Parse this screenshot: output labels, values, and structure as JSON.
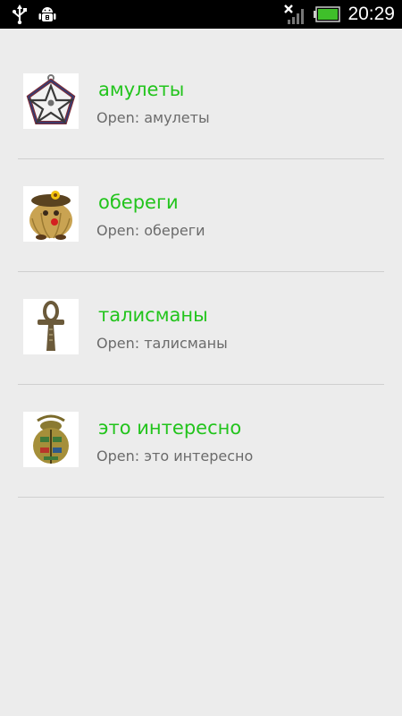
{
  "status_bar": {
    "time": "20:29",
    "icons": [
      "usb-icon",
      "android-debug-icon",
      "no-signal-icon",
      "battery-icon"
    ],
    "battery_color": "#3fbf2a"
  },
  "list": {
    "accent_color": "#22c41c",
    "items": [
      {
        "title": "амулеты",
        "subtitle": "Open: амулеты",
        "icon": "pentagram-amulet-icon"
      },
      {
        "title": "обереги",
        "subtitle": "Open: обереги",
        "icon": "straw-doll-icon"
      },
      {
        "title": "талисманы",
        "subtitle": "Open: талисманы",
        "icon": "ankh-icon"
      },
      {
        "title": "это интересно",
        "subtitle": "Open: это интересно",
        "icon": "scarab-icon"
      }
    ]
  }
}
